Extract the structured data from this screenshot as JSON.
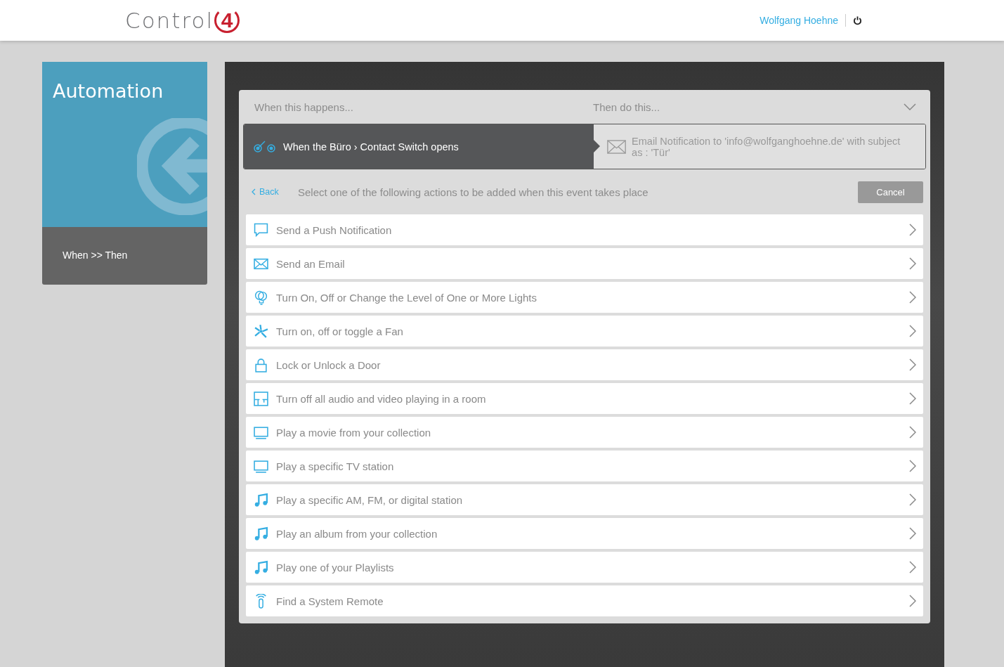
{
  "header": {
    "logo_text": "Control",
    "logo_mark": "4",
    "user": "Wolfgang Hoehne"
  },
  "sidebar": {
    "title": "Automation",
    "subtitle": "When >> Then"
  },
  "rule": {
    "when_heading": "When this happens...",
    "then_heading": "Then do this...",
    "trigger": "When the Büro › Contact Switch opens",
    "action": "Email Notification to 'info@wolfganghoehne.de' with subject as : 'Tür'"
  },
  "picker": {
    "back": "Back",
    "prompt": "Select one of the following actions to be added when this event takes place",
    "cancel": "Cancel",
    "actions": [
      {
        "kind": "chat",
        "label": "Send a Push Notification"
      },
      {
        "kind": "email",
        "label": "Send an Email"
      },
      {
        "kind": "bulb",
        "label": "Turn On, Off or Change the Level of One or More Lights"
      },
      {
        "kind": "fan",
        "label": "Turn on, off or toggle a Fan"
      },
      {
        "kind": "lock",
        "label": "Lock or Unlock a Door"
      },
      {
        "kind": "room",
        "label": "Turn off all audio and video playing in a room"
      },
      {
        "kind": "tv",
        "label": "Play a movie from your collection"
      },
      {
        "kind": "tv",
        "label": "Play a specific TV station"
      },
      {
        "kind": "music",
        "label": "Play a specific AM, FM, or digital station"
      },
      {
        "kind": "music",
        "label": "Play an album from your collection"
      },
      {
        "kind": "music",
        "label": "Play one of your Playlists"
      },
      {
        "kind": "remote",
        "label": "Find a System Remote"
      }
    ]
  }
}
